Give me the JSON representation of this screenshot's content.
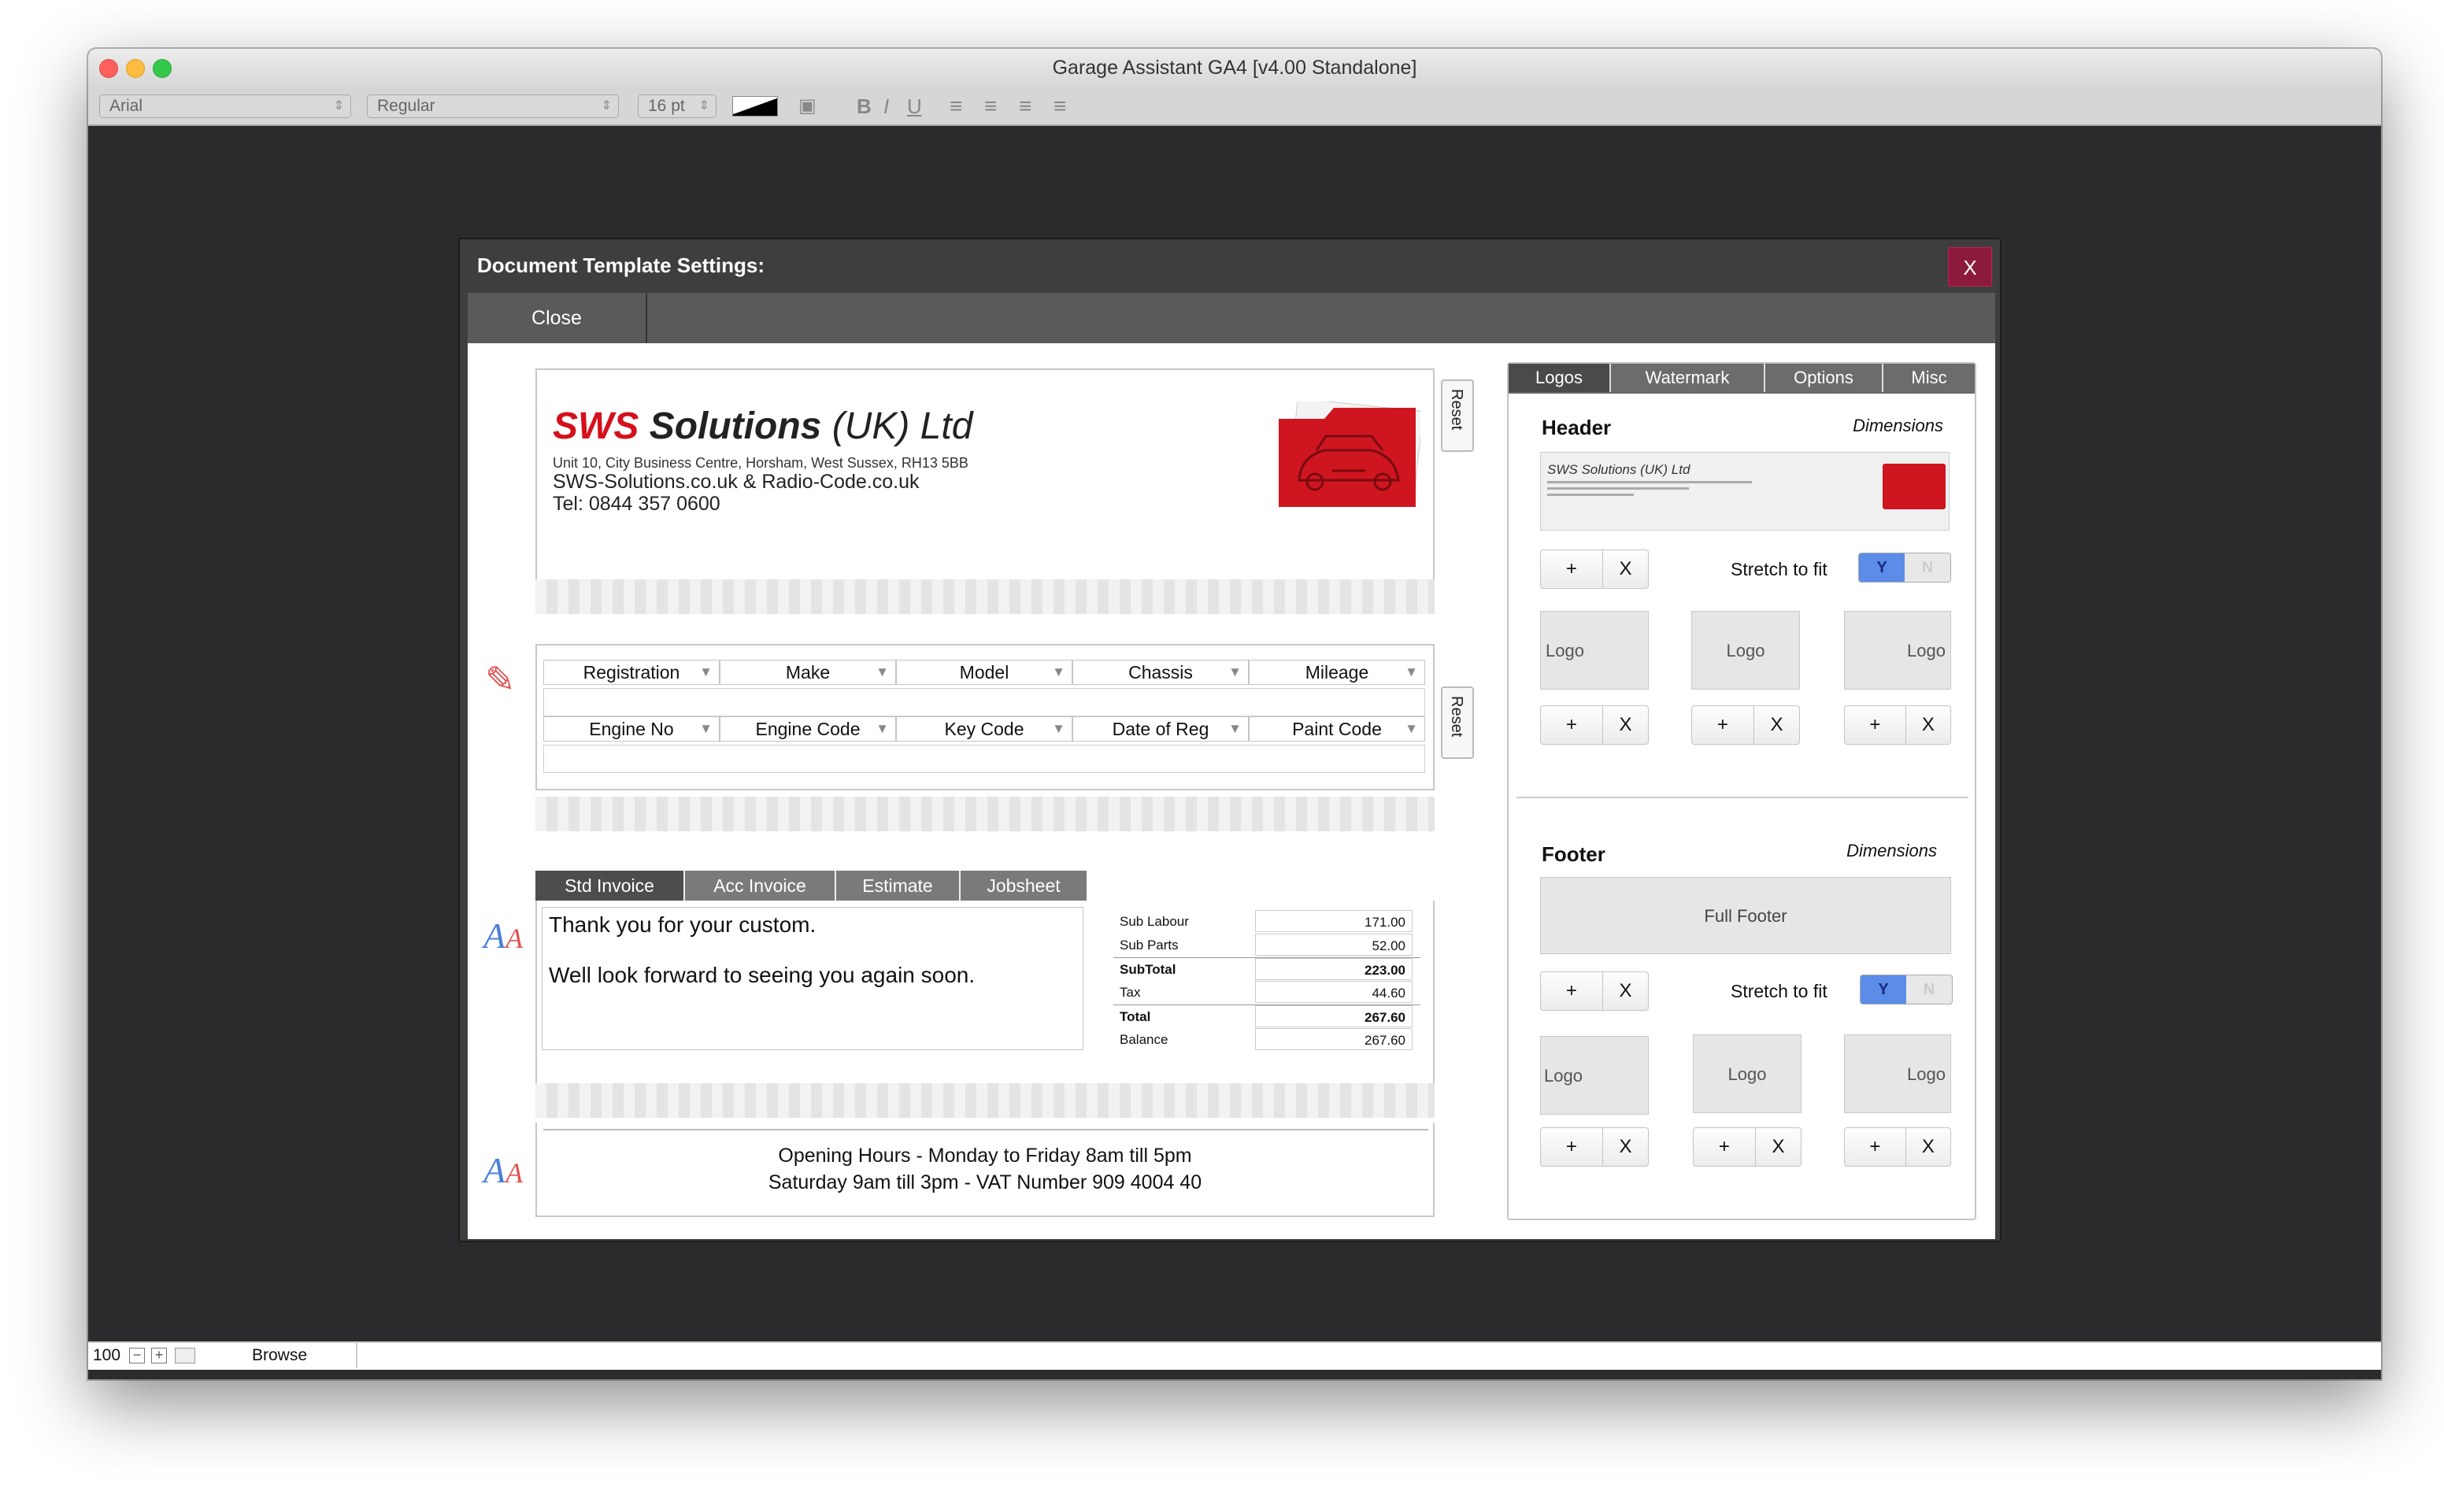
{
  "window": {
    "title": "Garage Assistant GA4 [v4.00 Standalone]"
  },
  "toolbar": {
    "font": "Arial",
    "style": "Regular",
    "size": "16 pt",
    "bold": "B",
    "italic": "I",
    "underline": "U"
  },
  "statusbar": {
    "zoom": "100",
    "mode": "Browse"
  },
  "dialog": {
    "title": "Document Template Settings:",
    "close_x": "X",
    "close_button": "Close"
  },
  "header_preview": {
    "company_bold": "SWS",
    "company_rest": "Solutions",
    "company_suffix": "(UK) Ltd",
    "address": "Unit 10, City Business Centre, Horsham, West Sussex, RH13 5BB",
    "websites": "SWS-Solutions.co.uk & Radio-Code.co.uk",
    "tel": "Tel: 0844 357 0600",
    "reset": "Reset"
  },
  "vehicle_fields": {
    "row1": [
      "Registration",
      "Make",
      "Model",
      "Chassis",
      "Mileage"
    ],
    "row2": [
      "Engine No",
      "Engine Code",
      "Key Code",
      "Date of Reg",
      "Paint Code"
    ],
    "reset": "Reset"
  },
  "doc_tabs": [
    "Std Invoice",
    "Acc Invoice",
    "Estimate",
    "Jobsheet"
  ],
  "invoice_message": {
    "line1": "Thank you for your custom.",
    "line2": "Well look forward to seeing you again soon."
  },
  "totals": [
    {
      "label": "Sub Labour",
      "value": "171.00",
      "bold": false
    },
    {
      "label": "Sub Parts",
      "value": "52.00",
      "bold": false
    },
    {
      "label": "SubTotal",
      "value": "223.00",
      "bold": true
    },
    {
      "label": "Tax",
      "value": "44.60",
      "bold": false
    },
    {
      "label": "Total",
      "value": "267.60",
      "bold": true
    },
    {
      "label": "Balance",
      "value": "267.60",
      "bold": false
    }
  ],
  "footer_text": {
    "line1": "Opening Hours - Monday to Friday 8am till 5pm",
    "line2": "Saturday 9am till 3pm - VAT Number 909 4004 40"
  },
  "right_tabs": [
    "Logos",
    "Watermark",
    "Options",
    "Misc"
  ],
  "header_panel": {
    "title": "Header",
    "dimensions": "Dimensions",
    "stretch_label": "Stretch to fit",
    "y": "Y",
    "n": "N",
    "logo": "Logo",
    "mini_company": "SWS Solutions (UK) Ltd"
  },
  "footer_panel": {
    "title": "Footer",
    "dimensions": "Dimensions",
    "full_footer": "Full Footer",
    "stretch_label": "Stretch to fit",
    "y": "Y",
    "n": "N",
    "logo": "Logo"
  },
  "pm": {
    "plus": "+",
    "x": "X"
  },
  "colors": {
    "brand_red": "#d4101c",
    "close_red": "#8c1a3c",
    "toggle_blue": "#5b8ce8"
  },
  "icons": [
    "pencil-icon",
    "text-style-icon",
    "car-folder-icon"
  ]
}
